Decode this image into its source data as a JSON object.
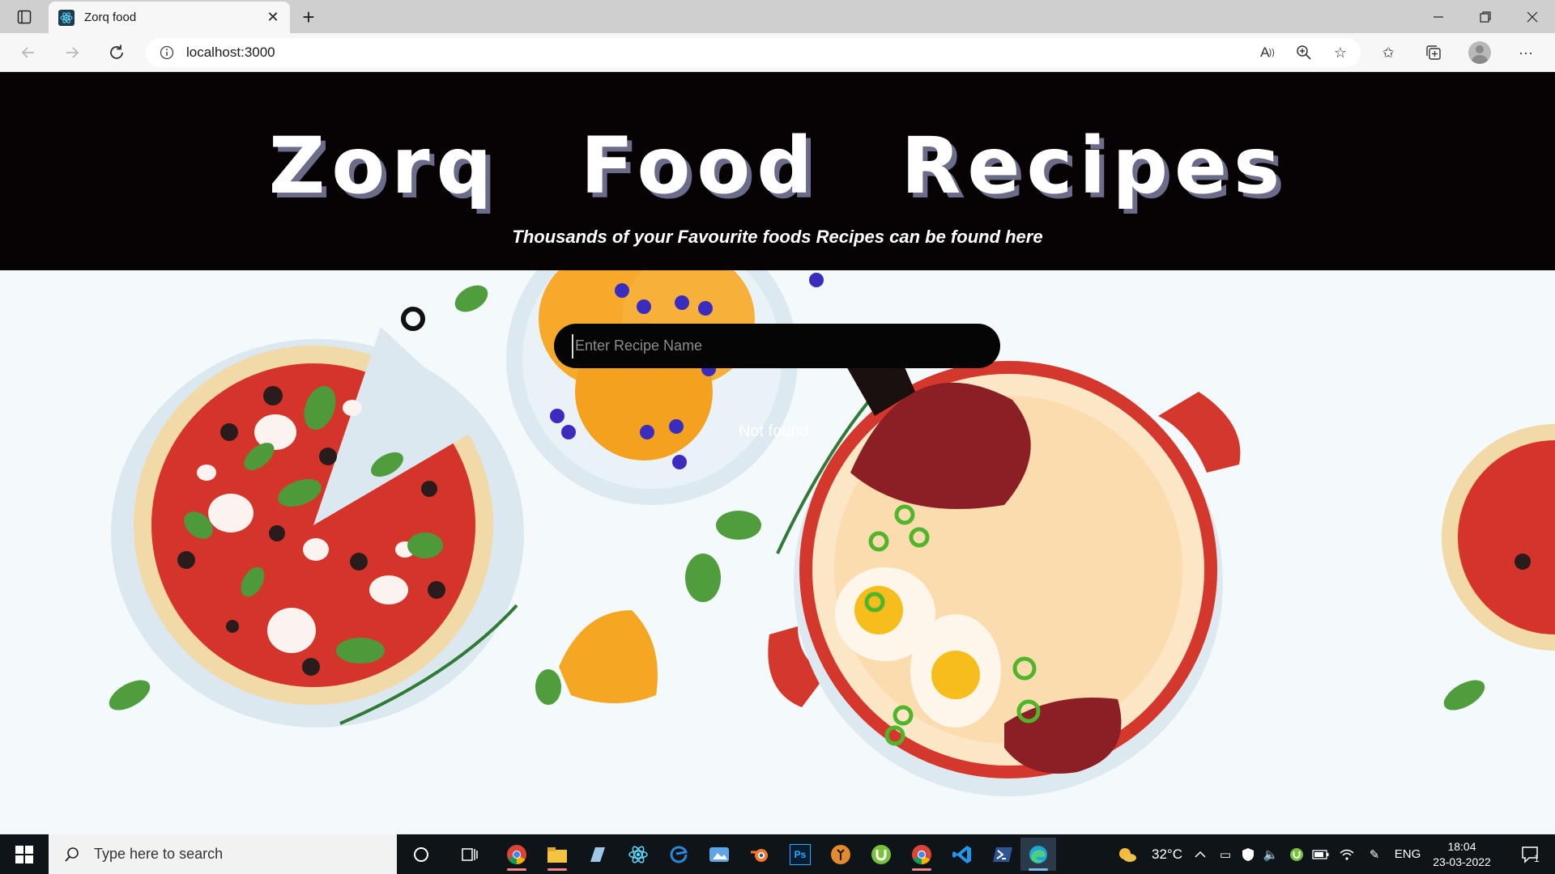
{
  "browser": {
    "tab_title": "Zorq food",
    "url": "localhost:3000",
    "icons": {
      "tab_actions": "tab-actions-icon",
      "favicon": "react-icon",
      "close": "close-icon",
      "new_tab": "plus-icon",
      "back": "back-arrow-icon",
      "forward": "forward-arrow-icon",
      "refresh": "refresh-icon",
      "site_info": "info-icon",
      "read_aloud": "read-aloud-icon",
      "zoom": "zoom-icon",
      "add_favorite": "add-favorite-icon",
      "favorites": "favorites-icon",
      "collections": "collections-icon",
      "profile": "profile-icon",
      "more": "more-icon",
      "minimize": "minimize-icon",
      "restore": "restore-icon",
      "window_close": "close-icon"
    }
  },
  "page": {
    "title": "Zorq Food Recipes",
    "tagline": "Thousands of your Favourite foods Recipes can be found here",
    "search": {
      "placeholder": "Enter Recipe Name",
      "value": ""
    },
    "status_message": "Not found"
  },
  "taskbar": {
    "search_placeholder": "Type here to search",
    "weather": "32°C",
    "language": "ENG",
    "time": "18:04",
    "date": "23-03-2022",
    "notifications": "1",
    "apps": [
      "chrome",
      "file-explorer",
      "sticky-notes",
      "react",
      "edge-dev",
      "photos",
      "blender",
      "photoshop",
      "unity",
      "utorrent",
      "chrome-profile",
      "vscode",
      "powershell",
      "edge"
    ]
  },
  "colors": {
    "header_bg": "#070203",
    "page_bg": "#f4f9fc",
    "search_bg": "#050505",
    "title_shadow": "#6b6b8a"
  }
}
